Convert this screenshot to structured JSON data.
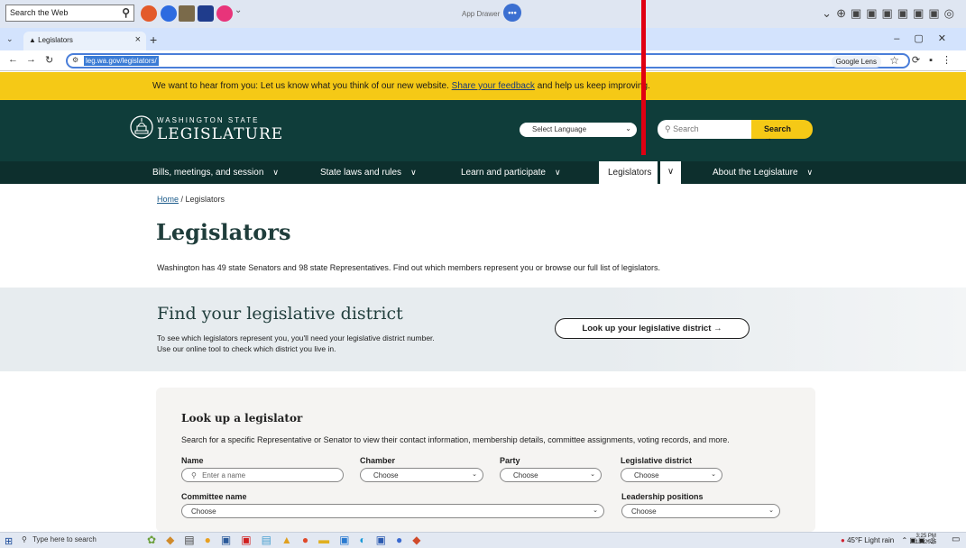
{
  "top_bar": {
    "web_search": "Search the Web",
    "app_drawer_label": "App Drawer",
    "app_drawer_sub": "More"
  },
  "tab": {
    "title": "Legislators"
  },
  "address_bar": {
    "url": "leg.wa.gov/legislators/",
    "lens_label": "Google Lens"
  },
  "banner": {
    "text_before": "We want to hear from you: Let us know what you think of our new website.",
    "link": "Share your feedback",
    "text_after": "and help us keep improving."
  },
  "header": {
    "logo_line1": "WASHINGTON STATE",
    "logo_line2": "LEGISLATURE",
    "language_select": "Select Language",
    "search_placeholder": "Search",
    "search_button": "Search →"
  },
  "nav": {
    "items": [
      "Bills, meetings, and session",
      "State laws and rules",
      "Learn and participate",
      "Legislators",
      "About the Legislature"
    ]
  },
  "breadcrumb": {
    "home": "Home",
    "current": "/ Legislators"
  },
  "page": {
    "title": "Legislators",
    "intro": "Washington has 49 state Senators and 98 state Representatives. Find out which members represent you or browse our full list of legislators."
  },
  "find_district": {
    "title": "Find your legislative district",
    "desc_line1": "To see which legislators represent you, you'll need your legislative district number.",
    "desc_line2": "Use our online tool to check which district you live in.",
    "button": "Look up your legislative district →"
  },
  "lookup": {
    "title": "Look up a legislator",
    "desc": "Search for a specific Representative or Senator to view their contact information, membership details, committee assignments, voting records, and more.",
    "name_label": "Name",
    "name_placeholder": "Enter a name",
    "chamber_label": "Chamber",
    "chamber_value": "Choose",
    "party_label": "Party",
    "party_value": "Choose",
    "district_label": "Legislative district",
    "district_value": "Choose",
    "committee_label": "Committee name",
    "committee_value": "Choose",
    "leadership_label": "Leadership positions",
    "leadership_value": "Choose"
  },
  "taskbar": {
    "search": "Type here to search",
    "weather": "45°F  Light rain",
    "time": "3:25 PM",
    "date": "1/2/2025"
  }
}
